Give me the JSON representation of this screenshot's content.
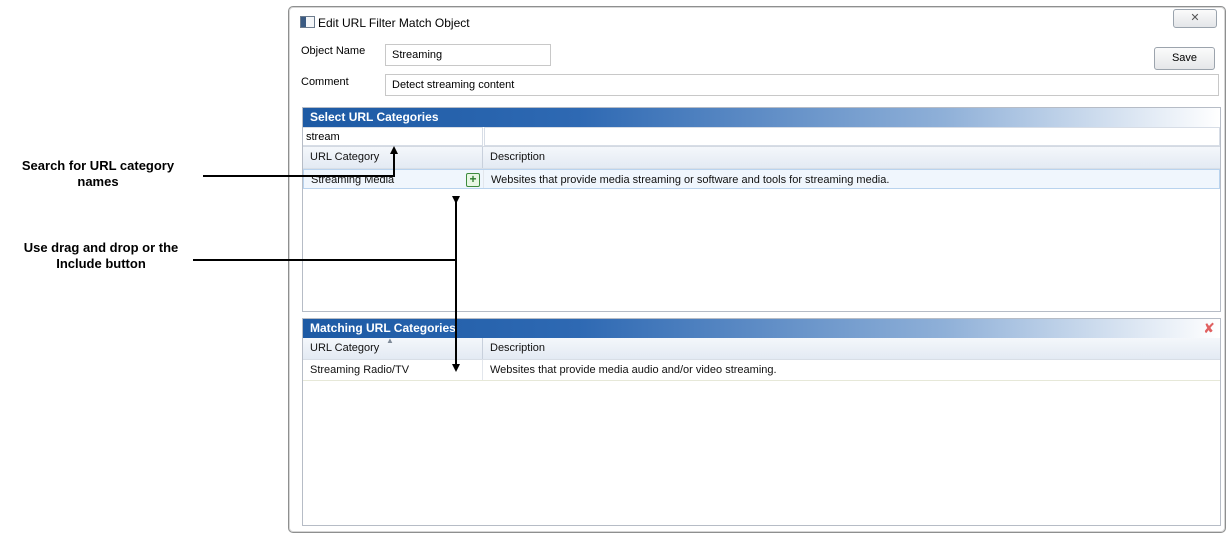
{
  "annotations": {
    "search_callout": "Search for URL category names",
    "drag_callout": "Use drag and drop or the Include button"
  },
  "window": {
    "title": "Edit URL Filter Match Object",
    "close_icon": "close-icon"
  },
  "form": {
    "object_name_label": "Object Name",
    "object_name_value": "Streaming",
    "comment_label": "Comment",
    "comment_value": "Detect streaming content",
    "save_label": "Save"
  },
  "select_panel": {
    "header": "Select URL Categories",
    "search_value": "stream",
    "columns": [
      "URL Category",
      "Description"
    ],
    "rows": [
      {
        "category": "Streaming Media",
        "description": "Websites that provide media streaming or software and tools for streaming media.",
        "action_icon": "include-plus-icon"
      }
    ]
  },
  "matching_panel": {
    "header": "Matching URL Categories",
    "clear_icon": "clear-x-icon",
    "columns": [
      "URL Category",
      "Description"
    ],
    "rows": [
      {
        "category": "Streaming Radio/TV",
        "description": "Websites that provide media audio and/or video streaming."
      }
    ]
  },
  "colors": {
    "header_blue": "#1d5aa4",
    "include_green": "#2d7d2d",
    "clear_red": "#e06060"
  }
}
